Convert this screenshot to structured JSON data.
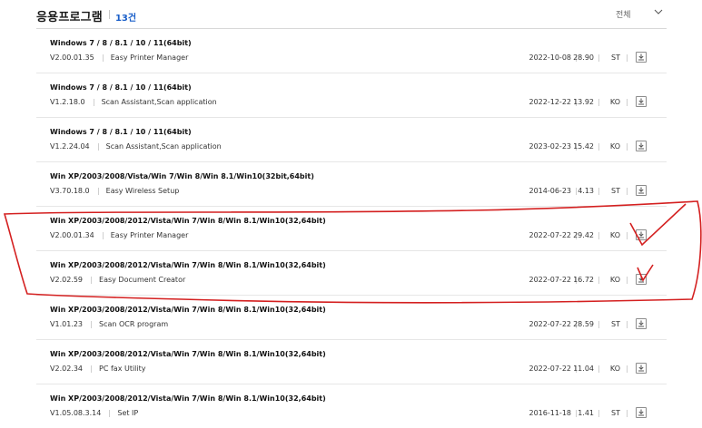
{
  "header": {
    "title": "응용프로그램",
    "count": "13건",
    "filter_value": "전체"
  },
  "programs": [
    {
      "os": "Windows 7 / 8 / 8.1 / 10 / 11(64bit)",
      "version": "V2.00.01.35",
      "name": "Easy Printer Manager",
      "date": "2022-10-08",
      "size": "28.90",
      "lang": "ST"
    },
    {
      "os": "Windows 7 / 8 / 8.1 / 10 / 11(64bit)",
      "version": "V1.2.18.0",
      "name": "Scan Assistant,Scan application",
      "date": "2022-12-22",
      "size": "13.92",
      "lang": "KO"
    },
    {
      "os": "Windows 7 / 8 / 8.1 / 10 / 11(64bit)",
      "version": "V1.2.24.04",
      "name": "Scan Assistant,Scan application",
      "date": "2023-02-23",
      "size": "15.42",
      "lang": "KO"
    },
    {
      "os": "Win XP/2003/2008/Vista/Win 7/Win 8/Win 8.1/Win10(32bit,64bit)",
      "version": "V3.70.18.0",
      "name": "Easy Wireless Setup",
      "date": "2014-06-23",
      "size": "4.13",
      "lang": "ST"
    },
    {
      "os": "Win XP/2003/2008/2012/Vista/Win 7/Win 8/Win 8.1/Win10(32,64bit)",
      "version": "V2.00.01.34",
      "name": "Easy Printer Manager",
      "date": "2022-07-22",
      "size": "29.42",
      "lang": "KO"
    },
    {
      "os": "Win XP/2003/2008/2012/Vista/Win 7/Win 8/Win 8.1/Win10(32,64bit)",
      "version": "V2.02.59",
      "name": "Easy Document Creator",
      "date": "2022-07-22",
      "size": "16.72",
      "lang": "KO"
    },
    {
      "os": "Win XP/2003/2008/2012/Vista/Win 7/Win 8/Win 8.1/Win10(32,64bit)",
      "version": "V1.01.23",
      "name": "Scan OCR program",
      "date": "2022-07-22",
      "size": "28.59",
      "lang": "ST"
    },
    {
      "os": "Win XP/2003/2008/2012/Vista/Win 7/Win 8/Win 8.1/Win10(32,64bit)",
      "version": "V2.02.34",
      "name": "PC fax Utility",
      "date": "2022-07-22",
      "size": "11.04",
      "lang": "KO"
    },
    {
      "os": "Win XP/2003/2008/2012/Vista/Win 7/Win 8/Win 8.1/Win10(32,64bit)",
      "version": "V1.05.08.3.14",
      "name": "Set IP",
      "date": "2016-11-18",
      "size": "1.41",
      "lang": "ST"
    }
  ],
  "icons": {
    "download": "download-icon",
    "dropdown": "chevron-down-icon"
  },
  "colors": {
    "count_accent": "#1a5fc9",
    "annotation": "#d42020"
  }
}
